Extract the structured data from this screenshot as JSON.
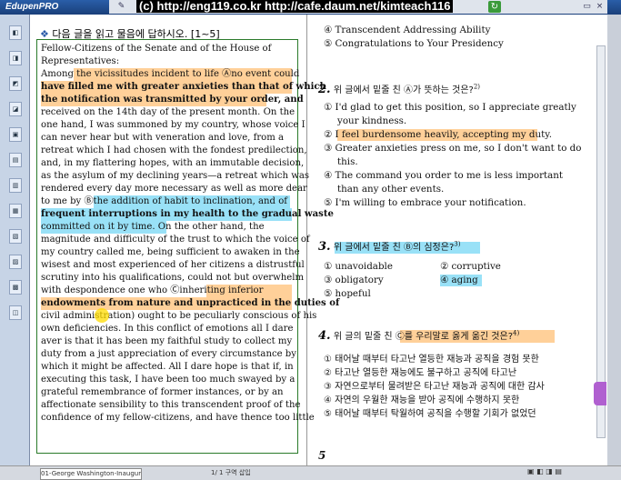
{
  "app": {
    "brand": "EdupenPRO",
    "watermark": "(c) http://eng119.co.kr  http://cafe.daum.net/kimteach116"
  },
  "colors": {
    "highlight_orange": "#ffaa46",
    "highlight_blue": "#46c8f0",
    "frame_green": "#2a7a2a"
  },
  "left_header": {
    "mark": "❖",
    "text": "다음 글을 읽고 물음에 답하시오. [1~5]"
  },
  "passage": [
    "Fellow-Citizens  of  the  Senate  and  of  the  House  of",
    "Representatives:",
    "Among the vicissitudes incident to life Ⓐno event could",
    "have filled me with greater anxieties than that of which",
    "the notification was transmitted by your order, and",
    "received on the 14th day of the present month. On the",
    "one hand, I was summoned by my country, whose voice I",
    "can never hear but with veneration and love, from a",
    "retreat which I had chosen with the fondest predilection,",
    "and, in my flattering hopes, with an immutable decision,",
    "as the asylum of my declining years—a retreat which was",
    "rendered every day more necessary as well as more dear",
    "to me by Ⓑthe addition of habit to inclination, and of",
    "frequent interruptions in my health to the gradual waste",
    "committed on it by time. On the other hand, the",
    "magnitude and difficulty of the trust to which the voice of",
    "my country called me, being sufficient to awaken in the",
    "wisest and most experienced of her citizens a distrustful",
    "scrutiny into his qualifications, could not but overwhelm",
    "with despondence    one    who    Ⓒinheriting inferior",
    "endowments from nature and unpracticed in the duties of",
    "civil administration) ought to be peculiarly conscious of his",
    "own deficiencies. In this conflict of emotions all I dare",
    "aver is that it has been my faithful study to collect my",
    "duty from a just appreciation of every circumstance by",
    "which it might be affected. All I dare hope is that if, in",
    "executing this task, I have been too much swayed by a",
    "grateful remembrance of former instances, or by an",
    "affectionate sensibility to this transcendent proof of the",
    "confidence of my fellow-citizens, and have thence too little"
  ],
  "right": {
    "q1_tail": [
      "④ Transcendent Addressing Ability",
      "⑤ Congratulations to Your Presidency"
    ],
    "q2": {
      "num": "2.",
      "text": "위 글에서 밑줄 친 Ⓐ가 뜻하는 것은?",
      "pts": "2)",
      "options": [
        "① I'd glad to get this position, so I appreciate greatly",
        "your kindness.",
        "② I feel burdensome heavily, accepting my duty.",
        "③ Greater anxieties press on me, so I don't want to do",
        "this.",
        "④ The command you order to me is less important",
        "than any other events.",
        "⑤ I'm willing to embrace your notification."
      ]
    },
    "q3": {
      "num": "3.",
      "text": "위 글에서 밑줄 친 Ⓑ의 심정은?",
      "pts": "3)",
      "options": [
        "① unavoidable",
        "② corruptive",
        "③ obligatory",
        "④ aging",
        "⑤ hopeful"
      ]
    },
    "q4": {
      "num": "4.",
      "text": "위 글의 밑줄 친 Ⓒ를 우리말로 옳게 옮긴 것은?",
      "pts": "4)",
      "options": [
        "① 태어날 때부터 타고난 열등한 재능과 공직을 경험 못한",
        "② 타고난 열등한 재능에도 불구하고 공직에 타고난",
        "③ 자연으로부터 물려받은 타고난 재능과 공직에 대한 감사",
        "④ 자연의 우월한 재능을 받아 공직에 수행하지 못한",
        "⑤ 태어날 때부터 탁월하여 공직을 수행할 기회가 없었던"
      ]
    },
    "q5_partial": "5"
  },
  "status": {
    "tab": "01-George Washington-Inaugural...",
    "page": "1/    1 구역   삽입"
  }
}
